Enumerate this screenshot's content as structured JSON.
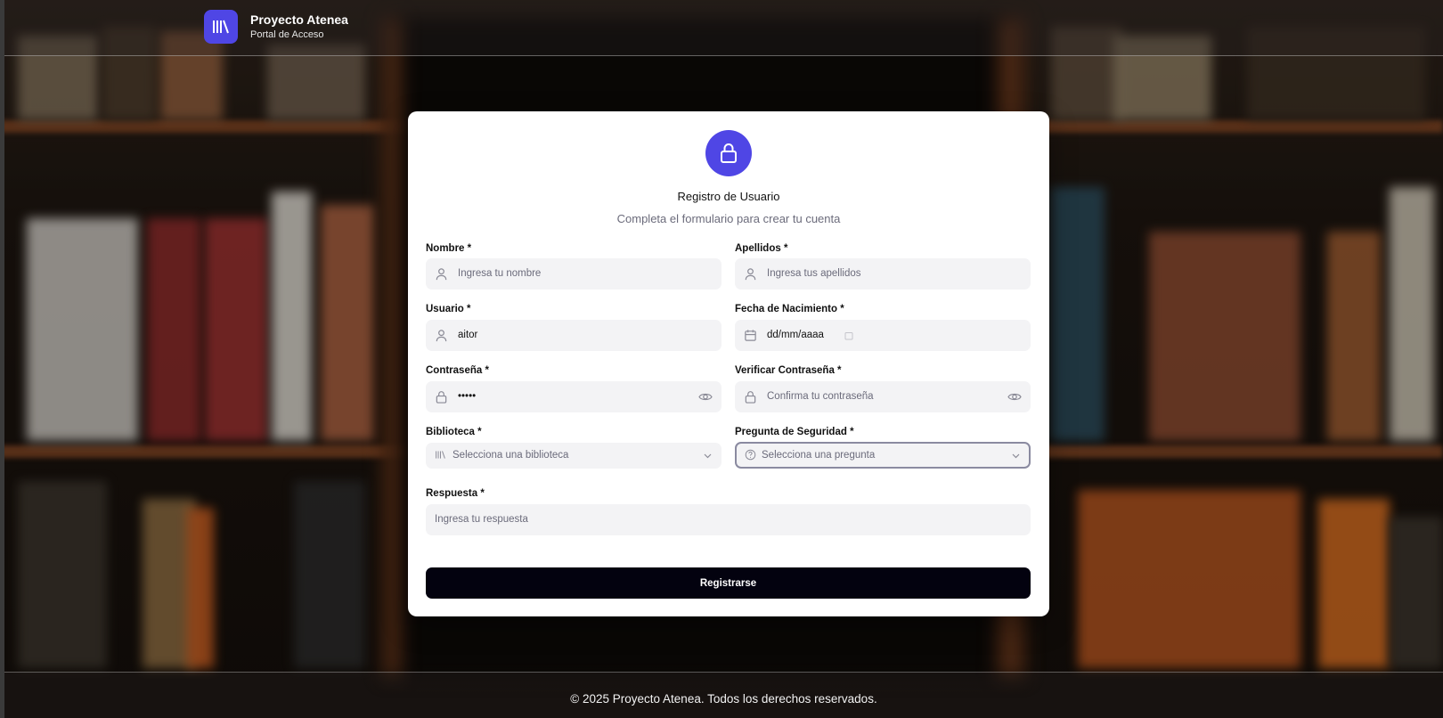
{
  "header": {
    "title": "Proyecto Atenea",
    "subtitle": "Portal de Acceso",
    "logo_icon": "library-icon"
  },
  "card": {
    "icon": "lock-icon",
    "title": "Registro de Usuario",
    "subtitle": "Completa el formulario para crear tu cuenta",
    "fields": {
      "nombre": {
        "label": "Nombre *",
        "placeholder": "Ingresa tu nombre",
        "value": ""
      },
      "apellidos": {
        "label": "Apellidos *",
        "placeholder": "Ingresa tus apellidos",
        "value": ""
      },
      "usuario": {
        "label": "Usuario *",
        "placeholder": "",
        "value": "aitor"
      },
      "fecha": {
        "label": "Fecha de Nacimiento *",
        "placeholder": "dd/mm/aaaa",
        "value": ""
      },
      "contrasena": {
        "label": "Contraseña *",
        "placeholder": "",
        "value": "•••••"
      },
      "verificar": {
        "label": "Verificar Contraseña *",
        "placeholder": "Confirma tu contraseña",
        "value": ""
      },
      "biblioteca": {
        "label": "Biblioteca *",
        "selected": "Selecciona una biblioteca"
      },
      "pregunta": {
        "label": "Pregunta de Seguridad *",
        "selected": "Selecciona una pregunta"
      },
      "respuesta": {
        "label": "Respuesta *",
        "placeholder": "Ingresa tu respuesta",
        "value": ""
      }
    },
    "submit_label": "Registrarse"
  },
  "footer": {
    "text": "© 2025 Proyecto Atenea. Todos los derechos reservados."
  },
  "colors": {
    "accent": "#4f46e5",
    "button": "#03020f",
    "field_bg": "#f3f3f5"
  }
}
